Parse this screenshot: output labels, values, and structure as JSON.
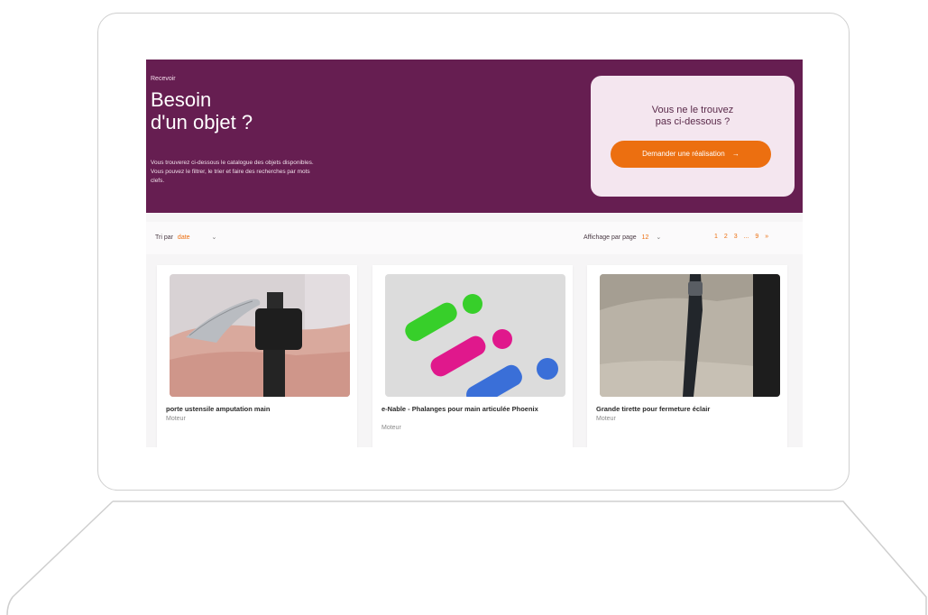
{
  "hero": {
    "eyebrow": "Recevoir",
    "title_line1": "Besoin",
    "title_line2": "d'un objet ?",
    "desc_line1": "Vous trouverez ci-dessous le catalogue des objets disponibles.",
    "desc_line2": "Vous pouvez le filtrer, le trier et faire des recherches par mots",
    "desc_line3": "clefs."
  },
  "cta": {
    "line1": "Vous ne le trouvez",
    "line2": "pas ci-dessous ?",
    "button_label": "Demander une réalisation",
    "button_arrow": "→"
  },
  "toolbar": {
    "sort_prefix": "Tri par",
    "sort_value": "date",
    "chevron": "⌄",
    "per_page_label": "Affichage par page",
    "per_page_value": "12",
    "pages": [
      "1",
      "2",
      "3",
      "...",
      "9",
      "»"
    ]
  },
  "products": [
    {
      "title": "porte ustensile amputation main",
      "category": "Moteur",
      "image": "wrist-utensil-holder-photo"
    },
    {
      "title": "e-Nable - Phalanges pour main articulée Phoenix",
      "category": "Moteur",
      "image": "3d-printed-phalanges-render"
    },
    {
      "title": "Grande tirette pour fermeture éclair",
      "category": "Moteur",
      "image": "zipper-pull-photo"
    }
  ],
  "colors": {
    "hero_bg": "#661e51",
    "accent": "#ec6f10",
    "cta_card_bg": "#f4e6ef"
  }
}
